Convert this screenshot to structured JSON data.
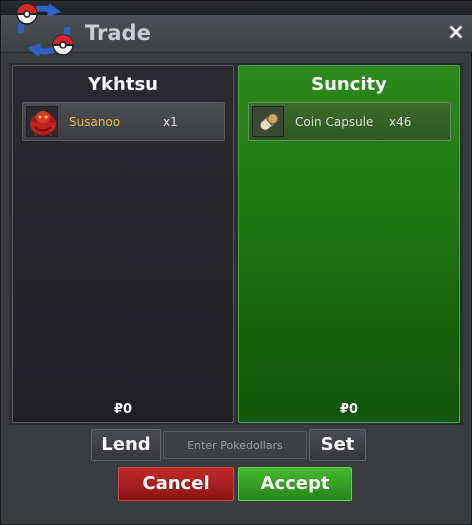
{
  "window": {
    "title": "Trade",
    "close_label": "×"
  },
  "panels": [
    {
      "player": "Ykhtsu",
      "items": [
        {
          "name": "Susanoo",
          "quantity": "x1",
          "icon": "red-creature-icon"
        }
      ],
      "money": "₽0",
      "accepted": false
    },
    {
      "player": "Suncity",
      "items": [
        {
          "name": "Coin Capsule",
          "quantity": "x46",
          "icon": "capsule-icon"
        }
      ],
      "money": "₽0",
      "accepted": true
    }
  ],
  "controls": {
    "lend_label": "Lend",
    "money_placeholder": "Enter Pokedollars",
    "set_label": "Set",
    "cancel_label": "Cancel",
    "accept_label": "Accept"
  },
  "colors": {
    "accepted_panel": "#1f7612",
    "cancel": "#b01f1f",
    "accept": "#35a023",
    "item_name_highlight": "#e4bf3a"
  }
}
